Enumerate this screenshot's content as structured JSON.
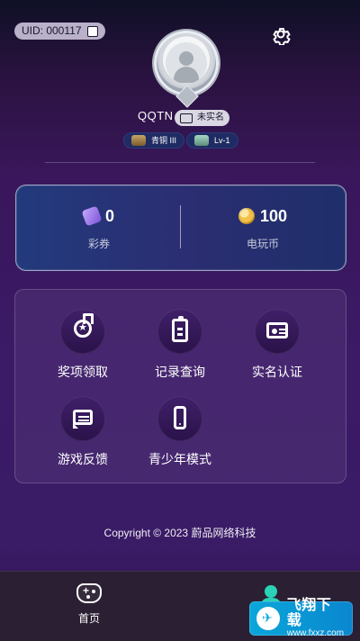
{
  "top": {
    "uid_text": "UID: 000117",
    "settings_icon": "gear-icon"
  },
  "profile": {
    "username": "QQTN",
    "real_name_status": "未实名",
    "rank_label": "青铜 III",
    "level_label": "Lv-1"
  },
  "wallet": {
    "tickets_value": "0",
    "tickets_label": "彩券",
    "coins_value": "100",
    "coins_label": "电玩币"
  },
  "menu": {
    "items": [
      {
        "label": "奖项领取",
        "icon": "medal-icon"
      },
      {
        "label": "记录查询",
        "icon": "clipboard-icon"
      },
      {
        "label": "实名认证",
        "icon": "id-card-icon"
      },
      {
        "label": "游戏反馈",
        "icon": "feedback-icon"
      },
      {
        "label": "青少年模式",
        "icon": "phone-icon"
      }
    ]
  },
  "footer": {
    "copyright": "Copyright © 2023 蔚品网络科技"
  },
  "tabbar": {
    "home_label": "首页",
    "home_icon": "game-controller-icon",
    "profile_icon": "person-icon"
  },
  "watermark": {
    "title": "飞翔下载",
    "subtitle": "www.fxxz.com"
  },
  "colors": {
    "accent_teal": "#2ad2b6",
    "wallet_border": "#ffffff",
    "tabbar_bg": "#2b2033"
  }
}
